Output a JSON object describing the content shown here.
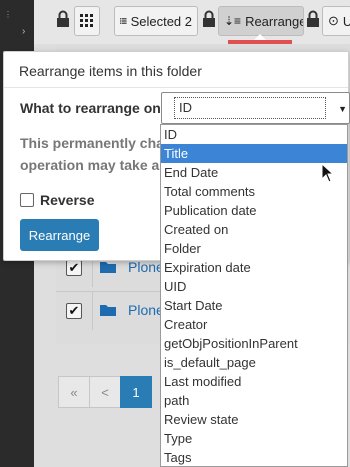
{
  "toolbar": {
    "selected_label": "Selected 2",
    "rearrange_label": "Rearrange",
    "upload_label": "U"
  },
  "modal": {
    "title": "Rearrange items in this folder",
    "field_label": "What to rearrange on",
    "select_value": "ID",
    "warning_line1": "This permanently cha",
    "warning_line2": "operation may take a",
    "reverse_label": "Reverse",
    "submit_label": "Rearrange"
  },
  "dropdown": {
    "options": [
      "ID",
      "Title",
      "End Date",
      "Total comments",
      "Publication date",
      "Created on",
      "Folder",
      "Expiration date",
      "UID",
      "Start Date",
      "Creator",
      "getObjPositionInParent",
      "is_default_page",
      "Last modified",
      "path",
      "Review state",
      "Type",
      "Tags"
    ],
    "highlighted": "Title"
  },
  "rows": [
    {
      "title": "Plone",
      "checked": "✔"
    },
    {
      "title": "Plone",
      "checked": "✔"
    }
  ],
  "pagination": {
    "first": "«",
    "prev": "<",
    "current": "1"
  },
  "colors": {
    "primary": "#2a7db4",
    "highlight": "#3b84d6",
    "marker": "#e05050"
  }
}
